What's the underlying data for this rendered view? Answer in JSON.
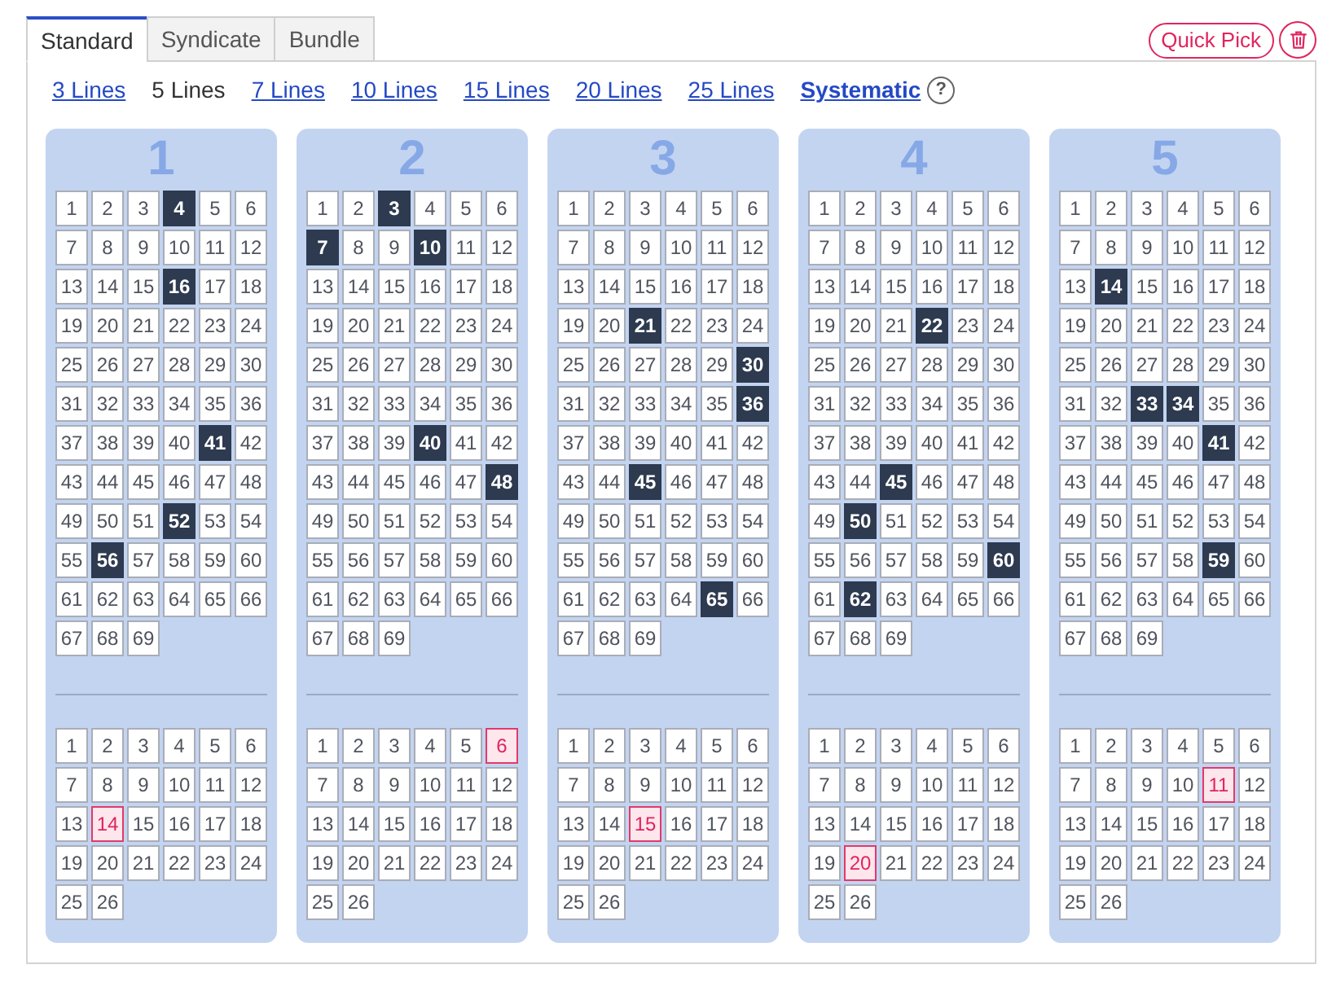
{
  "tabs": [
    {
      "label": "Standard",
      "selected": true
    },
    {
      "label": "Syndicate",
      "selected": false
    },
    {
      "label": "Bundle",
      "selected": false
    }
  ],
  "actions": {
    "quick_pick": "Quick Pick"
  },
  "line_options": [
    {
      "label": "3 Lines",
      "kind": "lines",
      "selected": false
    },
    {
      "label": "5 Lines",
      "kind": "lines",
      "selected": true
    },
    {
      "label": "7 Lines",
      "kind": "lines",
      "selected": false
    },
    {
      "label": "10 Lines",
      "kind": "lines",
      "selected": false
    },
    {
      "label": "15 Lines",
      "kind": "lines",
      "selected": false
    },
    {
      "label": "20 Lines",
      "kind": "lines",
      "selected": false
    },
    {
      "label": "25 Lines",
      "kind": "lines",
      "selected": false
    },
    {
      "label": "Systematic",
      "kind": "systematic",
      "selected": false
    }
  ],
  "help": "?",
  "lines": [
    {
      "line_number": "1",
      "main_numbers": [
        {
          "number": "1",
          "selected": false
        },
        {
          "number": "2",
          "selected": false
        },
        {
          "number": "3",
          "selected": false
        },
        {
          "number": "4",
          "selected": true
        },
        {
          "number": "5",
          "selected": false
        },
        {
          "number": "6",
          "selected": false
        },
        {
          "number": "7",
          "selected": false
        },
        {
          "number": "8",
          "selected": false
        },
        {
          "number": "9",
          "selected": false
        },
        {
          "number": "10",
          "selected": false
        },
        {
          "number": "11",
          "selected": false
        },
        {
          "number": "12",
          "selected": false
        },
        {
          "number": "13",
          "selected": false
        },
        {
          "number": "14",
          "selected": false
        },
        {
          "number": "15",
          "selected": false
        },
        {
          "number": "16",
          "selected": true
        },
        {
          "number": "17",
          "selected": false
        },
        {
          "number": "18",
          "selected": false
        },
        {
          "number": "19",
          "selected": false
        },
        {
          "number": "20",
          "selected": false
        },
        {
          "number": "21",
          "selected": false
        },
        {
          "number": "22",
          "selected": false
        },
        {
          "number": "23",
          "selected": false
        },
        {
          "number": "24",
          "selected": false
        },
        {
          "number": "25",
          "selected": false
        },
        {
          "number": "26",
          "selected": false
        },
        {
          "number": "27",
          "selected": false
        },
        {
          "number": "28",
          "selected": false
        },
        {
          "number": "29",
          "selected": false
        },
        {
          "number": "30",
          "selected": false
        },
        {
          "number": "31",
          "selected": false
        },
        {
          "number": "32",
          "selected": false
        },
        {
          "number": "33",
          "selected": false
        },
        {
          "number": "34",
          "selected": false
        },
        {
          "number": "35",
          "selected": false
        },
        {
          "number": "36",
          "selected": false
        },
        {
          "number": "37",
          "selected": false
        },
        {
          "number": "38",
          "selected": false
        },
        {
          "number": "39",
          "selected": false
        },
        {
          "number": "40",
          "selected": false
        },
        {
          "number": "41",
          "selected": true
        },
        {
          "number": "42",
          "selected": false
        },
        {
          "number": "43",
          "selected": false
        },
        {
          "number": "44",
          "selected": false
        },
        {
          "number": "45",
          "selected": false
        },
        {
          "number": "46",
          "selected": false
        },
        {
          "number": "47",
          "selected": false
        },
        {
          "number": "48",
          "selected": false
        },
        {
          "number": "49",
          "selected": false
        },
        {
          "number": "50",
          "selected": false
        },
        {
          "number": "51",
          "selected": false
        },
        {
          "number": "52",
          "selected": true
        },
        {
          "number": "53",
          "selected": false
        },
        {
          "number": "54",
          "selected": false
        },
        {
          "number": "55",
          "selected": false
        },
        {
          "number": "56",
          "selected": true
        },
        {
          "number": "57",
          "selected": false
        },
        {
          "number": "58",
          "selected": false
        },
        {
          "number": "59",
          "selected": false
        },
        {
          "number": "60",
          "selected": false
        },
        {
          "number": "61",
          "selected": false
        },
        {
          "number": "62",
          "selected": false
        },
        {
          "number": "63",
          "selected": false
        },
        {
          "number": "64",
          "selected": false
        },
        {
          "number": "65",
          "selected": false
        },
        {
          "number": "66",
          "selected": false
        },
        {
          "number": "67",
          "selected": false
        },
        {
          "number": "68",
          "selected": false
        },
        {
          "number": "69",
          "selected": false
        }
      ],
      "extra_numbers": [
        {
          "number": "1",
          "selected": false
        },
        {
          "number": "2",
          "selected": false
        },
        {
          "number": "3",
          "selected": false
        },
        {
          "number": "4",
          "selected": false
        },
        {
          "number": "5",
          "selected": false
        },
        {
          "number": "6",
          "selected": false
        },
        {
          "number": "7",
          "selected": false
        },
        {
          "number": "8",
          "selected": false
        },
        {
          "number": "9",
          "selected": false
        },
        {
          "number": "10",
          "selected": false
        },
        {
          "number": "11",
          "selected": false
        },
        {
          "number": "12",
          "selected": false
        },
        {
          "number": "13",
          "selected": false
        },
        {
          "number": "14",
          "selected": true
        },
        {
          "number": "15",
          "selected": false
        },
        {
          "number": "16",
          "selected": false
        },
        {
          "number": "17",
          "selected": false
        },
        {
          "number": "18",
          "selected": false
        },
        {
          "number": "19",
          "selected": false
        },
        {
          "number": "20",
          "selected": false
        },
        {
          "number": "21",
          "selected": false
        },
        {
          "number": "22",
          "selected": false
        },
        {
          "number": "23",
          "selected": false
        },
        {
          "number": "24",
          "selected": false
        },
        {
          "number": "25",
          "selected": false
        },
        {
          "number": "26",
          "selected": false
        }
      ]
    },
    {
      "line_number": "2",
      "main_numbers": [
        {
          "number": "1",
          "selected": false
        },
        {
          "number": "2",
          "selected": false
        },
        {
          "number": "3",
          "selected": true
        },
        {
          "number": "4",
          "selected": false
        },
        {
          "number": "5",
          "selected": false
        },
        {
          "number": "6",
          "selected": false
        },
        {
          "number": "7",
          "selected": true
        },
        {
          "number": "8",
          "selected": false
        },
        {
          "number": "9",
          "selected": false
        },
        {
          "number": "10",
          "selected": true
        },
        {
          "number": "11",
          "selected": false
        },
        {
          "number": "12",
          "selected": false
        },
        {
          "number": "13",
          "selected": false
        },
        {
          "number": "14",
          "selected": false
        },
        {
          "number": "15",
          "selected": false
        },
        {
          "number": "16",
          "selected": false
        },
        {
          "number": "17",
          "selected": false
        },
        {
          "number": "18",
          "selected": false
        },
        {
          "number": "19",
          "selected": false
        },
        {
          "number": "20",
          "selected": false
        },
        {
          "number": "21",
          "selected": false
        },
        {
          "number": "22",
          "selected": false
        },
        {
          "number": "23",
          "selected": false
        },
        {
          "number": "24",
          "selected": false
        },
        {
          "number": "25",
          "selected": false
        },
        {
          "number": "26",
          "selected": false
        },
        {
          "number": "27",
          "selected": false
        },
        {
          "number": "28",
          "selected": false
        },
        {
          "number": "29",
          "selected": false
        },
        {
          "number": "30",
          "selected": false
        },
        {
          "number": "31",
          "selected": false
        },
        {
          "number": "32",
          "selected": false
        },
        {
          "number": "33",
          "selected": false
        },
        {
          "number": "34",
          "selected": false
        },
        {
          "number": "35",
          "selected": false
        },
        {
          "number": "36",
          "selected": false
        },
        {
          "number": "37",
          "selected": false
        },
        {
          "number": "38",
          "selected": false
        },
        {
          "number": "39",
          "selected": false
        },
        {
          "number": "40",
          "selected": true
        },
        {
          "number": "41",
          "selected": false
        },
        {
          "number": "42",
          "selected": false
        },
        {
          "number": "43",
          "selected": false
        },
        {
          "number": "44",
          "selected": false
        },
        {
          "number": "45",
          "selected": false
        },
        {
          "number": "46",
          "selected": false
        },
        {
          "number": "47",
          "selected": false
        },
        {
          "number": "48",
          "selected": true
        },
        {
          "number": "49",
          "selected": false
        },
        {
          "number": "50",
          "selected": false
        },
        {
          "number": "51",
          "selected": false
        },
        {
          "number": "52",
          "selected": false
        },
        {
          "number": "53",
          "selected": false
        },
        {
          "number": "54",
          "selected": false
        },
        {
          "number": "55",
          "selected": false
        },
        {
          "number": "56",
          "selected": false
        },
        {
          "number": "57",
          "selected": false
        },
        {
          "number": "58",
          "selected": false
        },
        {
          "number": "59",
          "selected": false
        },
        {
          "number": "60",
          "selected": false
        },
        {
          "number": "61",
          "selected": false
        },
        {
          "number": "62",
          "selected": false
        },
        {
          "number": "63",
          "selected": false
        },
        {
          "number": "64",
          "selected": false
        },
        {
          "number": "65",
          "selected": false
        },
        {
          "number": "66",
          "selected": false
        },
        {
          "number": "67",
          "selected": false
        },
        {
          "number": "68",
          "selected": false
        },
        {
          "number": "69",
          "selected": false
        }
      ],
      "extra_numbers": [
        {
          "number": "1",
          "selected": false
        },
        {
          "number": "2",
          "selected": false
        },
        {
          "number": "3",
          "selected": false
        },
        {
          "number": "4",
          "selected": false
        },
        {
          "number": "5",
          "selected": false
        },
        {
          "number": "6",
          "selected": true
        },
        {
          "number": "7",
          "selected": false
        },
        {
          "number": "8",
          "selected": false
        },
        {
          "number": "9",
          "selected": false
        },
        {
          "number": "10",
          "selected": false
        },
        {
          "number": "11",
          "selected": false
        },
        {
          "number": "12",
          "selected": false
        },
        {
          "number": "13",
          "selected": false
        },
        {
          "number": "14",
          "selected": false
        },
        {
          "number": "15",
          "selected": false
        },
        {
          "number": "16",
          "selected": false
        },
        {
          "number": "17",
          "selected": false
        },
        {
          "number": "18",
          "selected": false
        },
        {
          "number": "19",
          "selected": false
        },
        {
          "number": "20",
          "selected": false
        },
        {
          "number": "21",
          "selected": false
        },
        {
          "number": "22",
          "selected": false
        },
        {
          "number": "23",
          "selected": false
        },
        {
          "number": "24",
          "selected": false
        },
        {
          "number": "25",
          "selected": false
        },
        {
          "number": "26",
          "selected": false
        }
      ]
    },
    {
      "line_number": "3",
      "main_numbers": [
        {
          "number": "1",
          "selected": false
        },
        {
          "number": "2",
          "selected": false
        },
        {
          "number": "3",
          "selected": false
        },
        {
          "number": "4",
          "selected": false
        },
        {
          "number": "5",
          "selected": false
        },
        {
          "number": "6",
          "selected": false
        },
        {
          "number": "7",
          "selected": false
        },
        {
          "number": "8",
          "selected": false
        },
        {
          "number": "9",
          "selected": false
        },
        {
          "number": "10",
          "selected": false
        },
        {
          "number": "11",
          "selected": false
        },
        {
          "number": "12",
          "selected": false
        },
        {
          "number": "13",
          "selected": false
        },
        {
          "number": "14",
          "selected": false
        },
        {
          "number": "15",
          "selected": false
        },
        {
          "number": "16",
          "selected": false
        },
        {
          "number": "17",
          "selected": false
        },
        {
          "number": "18",
          "selected": false
        },
        {
          "number": "19",
          "selected": false
        },
        {
          "number": "20",
          "selected": false
        },
        {
          "number": "21",
          "selected": true
        },
        {
          "number": "22",
          "selected": false
        },
        {
          "number": "23",
          "selected": false
        },
        {
          "number": "24",
          "selected": false
        },
        {
          "number": "25",
          "selected": false
        },
        {
          "number": "26",
          "selected": false
        },
        {
          "number": "27",
          "selected": false
        },
        {
          "number": "28",
          "selected": false
        },
        {
          "number": "29",
          "selected": false
        },
        {
          "number": "30",
          "selected": true
        },
        {
          "number": "31",
          "selected": false
        },
        {
          "number": "32",
          "selected": false
        },
        {
          "number": "33",
          "selected": false
        },
        {
          "number": "34",
          "selected": false
        },
        {
          "number": "35",
          "selected": false
        },
        {
          "number": "36",
          "selected": true
        },
        {
          "number": "37",
          "selected": false
        },
        {
          "number": "38",
          "selected": false
        },
        {
          "number": "39",
          "selected": false
        },
        {
          "number": "40",
          "selected": false
        },
        {
          "number": "41",
          "selected": false
        },
        {
          "number": "42",
          "selected": false
        },
        {
          "number": "43",
          "selected": false
        },
        {
          "number": "44",
          "selected": false
        },
        {
          "number": "45",
          "selected": true
        },
        {
          "number": "46",
          "selected": false
        },
        {
          "number": "47",
          "selected": false
        },
        {
          "number": "48",
          "selected": false
        },
        {
          "number": "49",
          "selected": false
        },
        {
          "number": "50",
          "selected": false
        },
        {
          "number": "51",
          "selected": false
        },
        {
          "number": "52",
          "selected": false
        },
        {
          "number": "53",
          "selected": false
        },
        {
          "number": "54",
          "selected": false
        },
        {
          "number": "55",
          "selected": false
        },
        {
          "number": "56",
          "selected": false
        },
        {
          "number": "57",
          "selected": false
        },
        {
          "number": "58",
          "selected": false
        },
        {
          "number": "59",
          "selected": false
        },
        {
          "number": "60",
          "selected": false
        },
        {
          "number": "61",
          "selected": false
        },
        {
          "number": "62",
          "selected": false
        },
        {
          "number": "63",
          "selected": false
        },
        {
          "number": "64",
          "selected": false
        },
        {
          "number": "65",
          "selected": true
        },
        {
          "number": "66",
          "selected": false
        },
        {
          "number": "67",
          "selected": false
        },
        {
          "number": "68",
          "selected": false
        },
        {
          "number": "69",
          "selected": false
        }
      ],
      "extra_numbers": [
        {
          "number": "1",
          "selected": false
        },
        {
          "number": "2",
          "selected": false
        },
        {
          "number": "3",
          "selected": false
        },
        {
          "number": "4",
          "selected": false
        },
        {
          "number": "5",
          "selected": false
        },
        {
          "number": "6",
          "selected": false
        },
        {
          "number": "7",
          "selected": false
        },
        {
          "number": "8",
          "selected": false
        },
        {
          "number": "9",
          "selected": false
        },
        {
          "number": "10",
          "selected": false
        },
        {
          "number": "11",
          "selected": false
        },
        {
          "number": "12",
          "selected": false
        },
        {
          "number": "13",
          "selected": false
        },
        {
          "number": "14",
          "selected": false
        },
        {
          "number": "15",
          "selected": true
        },
        {
          "number": "16",
          "selected": false
        },
        {
          "number": "17",
          "selected": false
        },
        {
          "number": "18",
          "selected": false
        },
        {
          "number": "19",
          "selected": false
        },
        {
          "number": "20",
          "selected": false
        },
        {
          "number": "21",
          "selected": false
        },
        {
          "number": "22",
          "selected": false
        },
        {
          "number": "23",
          "selected": false
        },
        {
          "number": "24",
          "selected": false
        },
        {
          "number": "25",
          "selected": false
        },
        {
          "number": "26",
          "selected": false
        }
      ]
    },
    {
      "line_number": "4",
      "main_numbers": [
        {
          "number": "1",
          "selected": false
        },
        {
          "number": "2",
          "selected": false
        },
        {
          "number": "3",
          "selected": false
        },
        {
          "number": "4",
          "selected": false
        },
        {
          "number": "5",
          "selected": false
        },
        {
          "number": "6",
          "selected": false
        },
        {
          "number": "7",
          "selected": false
        },
        {
          "number": "8",
          "selected": false
        },
        {
          "number": "9",
          "selected": false
        },
        {
          "number": "10",
          "selected": false
        },
        {
          "number": "11",
          "selected": false
        },
        {
          "number": "12",
          "selected": false
        },
        {
          "number": "13",
          "selected": false
        },
        {
          "number": "14",
          "selected": false
        },
        {
          "number": "15",
          "selected": false
        },
        {
          "number": "16",
          "selected": false
        },
        {
          "number": "17",
          "selected": false
        },
        {
          "number": "18",
          "selected": false
        },
        {
          "number": "19",
          "selected": false
        },
        {
          "number": "20",
          "selected": false
        },
        {
          "number": "21",
          "selected": false
        },
        {
          "number": "22",
          "selected": true
        },
        {
          "number": "23",
          "selected": false
        },
        {
          "number": "24",
          "selected": false
        },
        {
          "number": "25",
          "selected": false
        },
        {
          "number": "26",
          "selected": false
        },
        {
          "number": "27",
          "selected": false
        },
        {
          "number": "28",
          "selected": false
        },
        {
          "number": "29",
          "selected": false
        },
        {
          "number": "30",
          "selected": false
        },
        {
          "number": "31",
          "selected": false
        },
        {
          "number": "32",
          "selected": false
        },
        {
          "number": "33",
          "selected": false
        },
        {
          "number": "34",
          "selected": false
        },
        {
          "number": "35",
          "selected": false
        },
        {
          "number": "36",
          "selected": false
        },
        {
          "number": "37",
          "selected": false
        },
        {
          "number": "38",
          "selected": false
        },
        {
          "number": "39",
          "selected": false
        },
        {
          "number": "40",
          "selected": false
        },
        {
          "number": "41",
          "selected": false
        },
        {
          "number": "42",
          "selected": false
        },
        {
          "number": "43",
          "selected": false
        },
        {
          "number": "44",
          "selected": false
        },
        {
          "number": "45",
          "selected": true
        },
        {
          "number": "46",
          "selected": false
        },
        {
          "number": "47",
          "selected": false
        },
        {
          "number": "48",
          "selected": false
        },
        {
          "number": "49",
          "selected": false
        },
        {
          "number": "50",
          "selected": true
        },
        {
          "number": "51",
          "selected": false
        },
        {
          "number": "52",
          "selected": false
        },
        {
          "number": "53",
          "selected": false
        },
        {
          "number": "54",
          "selected": false
        },
        {
          "number": "55",
          "selected": false
        },
        {
          "number": "56",
          "selected": false
        },
        {
          "number": "57",
          "selected": false
        },
        {
          "number": "58",
          "selected": false
        },
        {
          "number": "59",
          "selected": false
        },
        {
          "number": "60",
          "selected": true
        },
        {
          "number": "61",
          "selected": false
        },
        {
          "number": "62",
          "selected": true
        },
        {
          "number": "63",
          "selected": false
        },
        {
          "number": "64",
          "selected": false
        },
        {
          "number": "65",
          "selected": false
        },
        {
          "number": "66",
          "selected": false
        },
        {
          "number": "67",
          "selected": false
        },
        {
          "number": "68",
          "selected": false
        },
        {
          "number": "69",
          "selected": false
        }
      ],
      "extra_numbers": [
        {
          "number": "1",
          "selected": false
        },
        {
          "number": "2",
          "selected": false
        },
        {
          "number": "3",
          "selected": false
        },
        {
          "number": "4",
          "selected": false
        },
        {
          "number": "5",
          "selected": false
        },
        {
          "number": "6",
          "selected": false
        },
        {
          "number": "7",
          "selected": false
        },
        {
          "number": "8",
          "selected": false
        },
        {
          "number": "9",
          "selected": false
        },
        {
          "number": "10",
          "selected": false
        },
        {
          "number": "11",
          "selected": false
        },
        {
          "number": "12",
          "selected": false
        },
        {
          "number": "13",
          "selected": false
        },
        {
          "number": "14",
          "selected": false
        },
        {
          "number": "15",
          "selected": false
        },
        {
          "number": "16",
          "selected": false
        },
        {
          "number": "17",
          "selected": false
        },
        {
          "number": "18",
          "selected": false
        },
        {
          "number": "19",
          "selected": false
        },
        {
          "number": "20",
          "selected": true
        },
        {
          "number": "21",
          "selected": false
        },
        {
          "number": "22",
          "selected": false
        },
        {
          "number": "23",
          "selected": false
        },
        {
          "number": "24",
          "selected": false
        },
        {
          "number": "25",
          "selected": false
        },
        {
          "number": "26",
          "selected": false
        }
      ]
    },
    {
      "line_number": "5",
      "main_numbers": [
        {
          "number": "1",
          "selected": false
        },
        {
          "number": "2",
          "selected": false
        },
        {
          "number": "3",
          "selected": false
        },
        {
          "number": "4",
          "selected": false
        },
        {
          "number": "5",
          "selected": false
        },
        {
          "number": "6",
          "selected": false
        },
        {
          "number": "7",
          "selected": false
        },
        {
          "number": "8",
          "selected": false
        },
        {
          "number": "9",
          "selected": false
        },
        {
          "number": "10",
          "selected": false
        },
        {
          "number": "11",
          "selected": false
        },
        {
          "number": "12",
          "selected": false
        },
        {
          "number": "13",
          "selected": false
        },
        {
          "number": "14",
          "selected": true
        },
        {
          "number": "15",
          "selected": false
        },
        {
          "number": "16",
          "selected": false
        },
        {
          "number": "17",
          "selected": false
        },
        {
          "number": "18",
          "selected": false
        },
        {
          "number": "19",
          "selected": false
        },
        {
          "number": "20",
          "selected": false
        },
        {
          "number": "21",
          "selected": false
        },
        {
          "number": "22",
          "selected": false
        },
        {
          "number": "23",
          "selected": false
        },
        {
          "number": "24",
          "selected": false
        },
        {
          "number": "25",
          "selected": false
        },
        {
          "number": "26",
          "selected": false
        },
        {
          "number": "27",
          "selected": false
        },
        {
          "number": "28",
          "selected": false
        },
        {
          "number": "29",
          "selected": false
        },
        {
          "number": "30",
          "selected": false
        },
        {
          "number": "31",
          "selected": false
        },
        {
          "number": "32",
          "selected": false
        },
        {
          "number": "33",
          "selected": true
        },
        {
          "number": "34",
          "selected": true
        },
        {
          "number": "35",
          "selected": false
        },
        {
          "number": "36",
          "selected": false
        },
        {
          "number": "37",
          "selected": false
        },
        {
          "number": "38",
          "selected": false
        },
        {
          "number": "39",
          "selected": false
        },
        {
          "number": "40",
          "selected": false
        },
        {
          "number": "41",
          "selected": true
        },
        {
          "number": "42",
          "selected": false
        },
        {
          "number": "43",
          "selected": false
        },
        {
          "number": "44",
          "selected": false
        },
        {
          "number": "45",
          "selected": false
        },
        {
          "number": "46",
          "selected": false
        },
        {
          "number": "47",
          "selected": false
        },
        {
          "number": "48",
          "selected": false
        },
        {
          "number": "49",
          "selected": false
        },
        {
          "number": "50",
          "selected": false
        },
        {
          "number": "51",
          "selected": false
        },
        {
          "number": "52",
          "selected": false
        },
        {
          "number": "53",
          "selected": false
        },
        {
          "number": "54",
          "selected": false
        },
        {
          "number": "55",
          "selected": false
        },
        {
          "number": "56",
          "selected": false
        },
        {
          "number": "57",
          "selected": false
        },
        {
          "number": "58",
          "selected": false
        },
        {
          "number": "59",
          "selected": true
        },
        {
          "number": "60",
          "selected": false
        },
        {
          "number": "61",
          "selected": false
        },
        {
          "number": "62",
          "selected": false
        },
        {
          "number": "63",
          "selected": false
        },
        {
          "number": "64",
          "selected": false
        },
        {
          "number": "65",
          "selected": false
        },
        {
          "number": "66",
          "selected": false
        },
        {
          "number": "67",
          "selected": false
        },
        {
          "number": "68",
          "selected": false
        },
        {
          "number": "69",
          "selected": false
        }
      ],
      "extra_numbers": [
        {
          "number": "1",
          "selected": false
        },
        {
          "number": "2",
          "selected": false
        },
        {
          "number": "3",
          "selected": false
        },
        {
          "number": "4",
          "selected": false
        },
        {
          "number": "5",
          "selected": false
        },
        {
          "number": "6",
          "selected": false
        },
        {
          "number": "7",
          "selected": false
        },
        {
          "number": "8",
          "selected": false
        },
        {
          "number": "9",
          "selected": false
        },
        {
          "number": "10",
          "selected": false
        },
        {
          "number": "11",
          "selected": true
        },
        {
          "number": "12",
          "selected": false
        },
        {
          "number": "13",
          "selected": false
        },
        {
          "number": "14",
          "selected": false
        },
        {
          "number": "15",
          "selected": false
        },
        {
          "number": "16",
          "selected": false
        },
        {
          "number": "17",
          "selected": false
        },
        {
          "number": "18",
          "selected": false
        },
        {
          "number": "19",
          "selected": false
        },
        {
          "number": "20",
          "selected": false
        },
        {
          "number": "21",
          "selected": false
        },
        {
          "number": "22",
          "selected": false
        },
        {
          "number": "23",
          "selected": false
        },
        {
          "number": "24",
          "selected": false
        },
        {
          "number": "25",
          "selected": false
        },
        {
          "number": "26",
          "selected": false
        }
      ]
    }
  ]
}
